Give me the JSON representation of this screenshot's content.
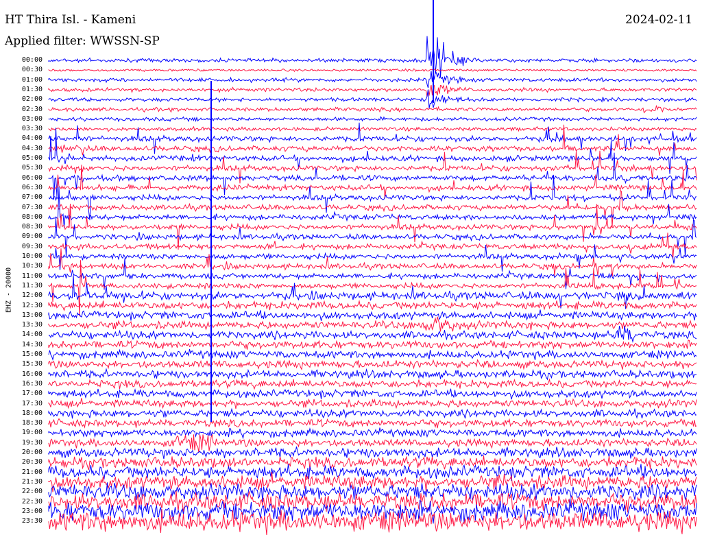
{
  "header": {
    "station": "HT Thira Isl. - Kameni",
    "date": "2024-02-11",
    "filter": "Applied filter: WWSSN-SP"
  },
  "chart_data": {
    "type": "line",
    "title": "HT Thira Isl. - Kameni",
    "ylabel": "EHZ - 20000",
    "colors": [
      "#0000ff",
      "#ff1744"
    ],
    "rows": [
      {
        "time": "00:00",
        "color": "#0000ff"
      },
      {
        "time": "00:30",
        "color": "#ff1744"
      },
      {
        "time": "01:00",
        "color": "#0000ff"
      },
      {
        "time": "01:30",
        "color": "#ff1744"
      },
      {
        "time": "02:00",
        "color": "#0000ff"
      },
      {
        "time": "02:30",
        "color": "#ff1744"
      },
      {
        "time": "03:00",
        "color": "#0000ff"
      },
      {
        "time": "03:30",
        "color": "#ff1744"
      },
      {
        "time": "04:00",
        "color": "#0000ff"
      },
      {
        "time": "04:30",
        "color": "#ff1744"
      },
      {
        "time": "05:00",
        "color": "#0000ff"
      },
      {
        "time": "05:30",
        "color": "#ff1744"
      },
      {
        "time": "06:00",
        "color": "#0000ff"
      },
      {
        "time": "06:30",
        "color": "#ff1744"
      },
      {
        "time": "07:00",
        "color": "#0000ff"
      },
      {
        "time": "07:30",
        "color": "#ff1744"
      },
      {
        "time": "08:00",
        "color": "#0000ff"
      },
      {
        "time": "08:30",
        "color": "#ff1744"
      },
      {
        "time": "09:00",
        "color": "#0000ff"
      },
      {
        "time": "09:30",
        "color": "#ff1744"
      },
      {
        "time": "10:00",
        "color": "#0000ff"
      },
      {
        "time": "10:30",
        "color": "#ff1744"
      },
      {
        "time": "11:00",
        "color": "#0000ff"
      },
      {
        "time": "11:30",
        "color": "#ff1744"
      },
      {
        "time": "12:00",
        "color": "#0000ff"
      },
      {
        "time": "12:30",
        "color": "#ff1744"
      },
      {
        "time": "13:00",
        "color": "#0000ff"
      },
      {
        "time": "13:30",
        "color": "#ff1744"
      },
      {
        "time": "14:00",
        "color": "#0000ff"
      },
      {
        "time": "14:30",
        "color": "#ff1744"
      },
      {
        "time": "15:00",
        "color": "#0000ff"
      },
      {
        "time": "15:30",
        "color": "#ff1744"
      },
      {
        "time": "16:00",
        "color": "#0000ff"
      },
      {
        "time": "16:30",
        "color": "#ff1744"
      },
      {
        "time": "17:00",
        "color": "#0000ff"
      },
      {
        "time": "17:30",
        "color": "#ff1744"
      },
      {
        "time": "18:00",
        "color": "#0000ff"
      },
      {
        "time": "18:30",
        "color": "#ff1744"
      },
      {
        "time": "19:00",
        "color": "#0000ff"
      },
      {
        "time": "19:30",
        "color": "#ff1744"
      },
      {
        "time": "20:00",
        "color": "#0000ff"
      },
      {
        "time": "20:30",
        "color": "#ff1744"
      },
      {
        "time": "21:00",
        "color": "#0000ff"
      },
      {
        "time": "21:30",
        "color": "#ff1744"
      },
      {
        "time": "22:00",
        "color": "#0000ff"
      },
      {
        "time": "22:30",
        "color": "#ff1744"
      },
      {
        "time": "23:00",
        "color": "#0000ff"
      },
      {
        "time": "23:30",
        "color": "#ff1744"
      }
    ]
  }
}
